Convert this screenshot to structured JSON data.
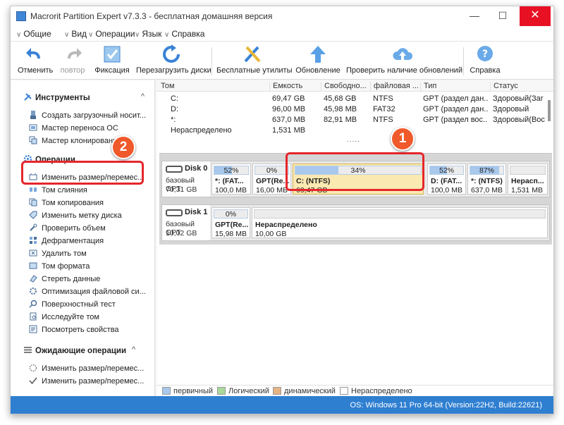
{
  "window": {
    "title": "Macrorit Partition Expert v7.3.3 - бесплатная домашняя версия",
    "min_glyph": "—",
    "max_glyph": "☐",
    "close_glyph": "✕"
  },
  "menu": [
    {
      "label": "Общие",
      "accel": "О"
    },
    {
      "label": "Вид",
      "accel": "В"
    },
    {
      "label": "Операции",
      "accel": "О"
    },
    {
      "label": "Язык",
      "accel": "Я"
    },
    {
      "label": "Справка",
      "accel": "С"
    }
  ],
  "toolbar": {
    "undo": "Отменить",
    "redo": "повтор",
    "commit": "Фиксация",
    "reboot": "Перезагрузить диски",
    "free_utils": "Бесплатные утилиты",
    "update": "Обновление",
    "check_updates": "Проверить наличие обновлений",
    "help": "Справка"
  },
  "sidebar": {
    "tools_header": "Инструменты",
    "tools": [
      "Создать загрузочный носит...",
      "Мастер переноса ОС",
      "Мастер клонирования"
    ],
    "ops_header": "Операции",
    "ops": [
      "Изменить размер/перемес...",
      "Том слияния",
      "Том копирования",
      "Изменить метку диска",
      "Проверить объем",
      "Дефрагментация",
      "Удалить том",
      "Том формата",
      "Стереть данные",
      "Оптимизация файловой си...",
      "Поверхностный тест",
      "Исследуйте том",
      "Посмотреть свойства"
    ],
    "pending_header": "Ожидающие операции",
    "pending": [
      "Изменить размер/перемес...",
      "Изменить размер/перемес..."
    ],
    "caret_up": "^"
  },
  "grid": {
    "columns": [
      "Том",
      "Емкость",
      "Свободно...",
      "файловая ...",
      "Тип",
      "Статус"
    ],
    "rows": [
      {
        "vol": "C:",
        "cap": "69,47 GB",
        "free": "45,68 GB",
        "fs": "NTFS",
        "type": "GPT (раздел дан...",
        "status": "Здоровый(Заг"
      },
      {
        "vol": "D:",
        "cap": "96,00 MB",
        "free": "45,98 MB",
        "fs": "FAT32",
        "type": "GPT (раздел дан...",
        "status": "Здоровый"
      },
      {
        "vol": "*:",
        "cap": "637,0 MB",
        "free": "82,91 MB",
        "fs": "NTFS",
        "type": "GPT (раздел вос...",
        "status": "Здоровый(Вос"
      },
      {
        "vol": "Нераспределено",
        "cap": "1,531 MB",
        "free": "",
        "fs": "",
        "type": "",
        "status": ""
      }
    ],
    "more": "....."
  },
  "disks": [
    {
      "name": "Disk 0",
      "type": "базовый GPT",
      "size": "70,31 GB",
      "partitions": [
        {
          "pct": "52%",
          "fill": 0.52,
          "name": "*: (FAT...",
          "size": "100,0 MB"
        },
        {
          "pct": "0%",
          "fill": 0.0,
          "name": "GPT(Re...",
          "size": "16,00 MB"
        },
        {
          "pct": "34%",
          "fill": 0.34,
          "name": "C: (NTFS)",
          "size": "69,47 GB",
          "selected": true
        },
        {
          "pct": "52%",
          "fill": 0.52,
          "name": "D: (FAT...",
          "size": "100,0 MB"
        },
        {
          "pct": "87%",
          "fill": 0.87,
          "name": "*: (NTFS)",
          "size": "637,0 MB"
        },
        {
          "pct": "",
          "fill": 0.0,
          "name": "Нерасп...",
          "size": "1,531 MB",
          "unalloc": true
        }
      ]
    },
    {
      "name": "Disk 1",
      "type": "базовый GPT",
      "size": "10,02 GB",
      "partitions": [
        {
          "pct": "0%",
          "fill": 0.0,
          "name": "GPT(Re...",
          "size": "15,98 MB"
        },
        {
          "pct": "",
          "fill": 0.0,
          "name": "Нераспределено",
          "size": "10,00 GB",
          "unalloc": true
        }
      ]
    }
  ],
  "legend": [
    {
      "label": "первичный",
      "color": "#a8c8ec"
    },
    {
      "label": "Логический",
      "color": "#a9d89a"
    },
    {
      "label": "динамический",
      "color": "#e6b483"
    },
    {
      "label": "Нераспределено",
      "color": "#ffffff"
    }
  ],
  "status": "OS: Windows 11 Pro 64-bit (Version:22H2, Build:22621)",
  "callouts": {
    "one": "1",
    "two": "2"
  },
  "colors": {
    "accent": "#2f7fd1",
    "highlight": "#e5262b",
    "badge": "#f0592a",
    "selected_partition": "#fbe9b2"
  }
}
